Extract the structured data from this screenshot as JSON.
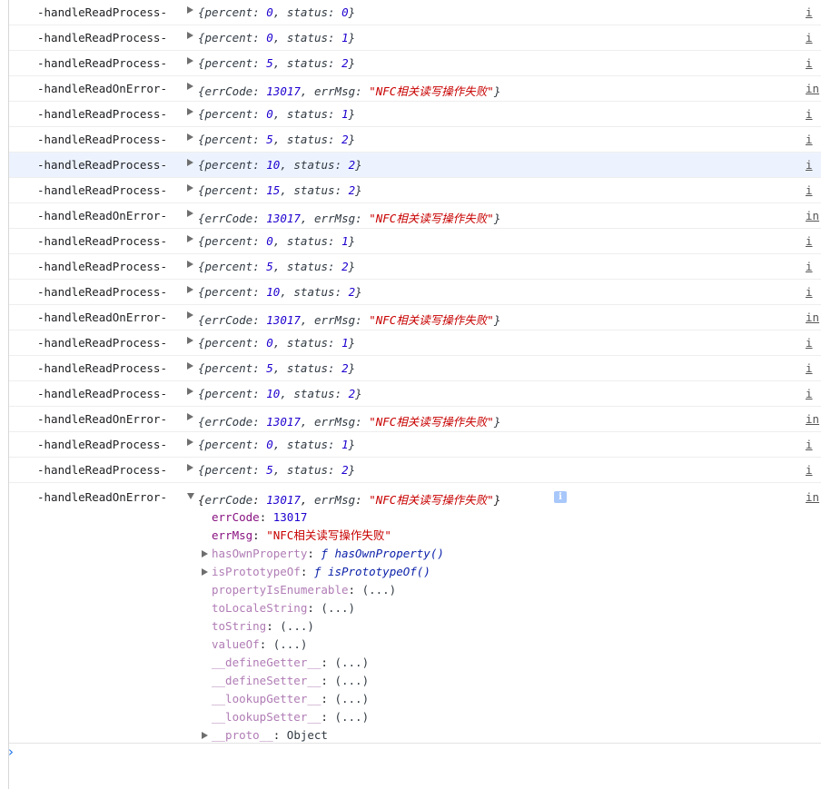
{
  "logs": [
    {
      "label": "-handleReadProcess-",
      "kind": "progress",
      "percent": "0",
      "status": "0",
      "src": "i"
    },
    {
      "label": "-handleReadProcess-",
      "kind": "progress",
      "percent": "0",
      "status": "1",
      "src": "i"
    },
    {
      "label": "-handleReadProcess-",
      "kind": "progress",
      "percent": "5",
      "status": "2",
      "src": "i"
    },
    {
      "label": "-handleReadOnError-",
      "kind": "error",
      "errCode": "13017",
      "errMsg": "\"NFC相关读写操作失败\"",
      "src": "in"
    },
    {
      "label": "-handleReadProcess-",
      "kind": "progress",
      "percent": "0",
      "status": "1",
      "src": "i"
    },
    {
      "label": "-handleReadProcess-",
      "kind": "progress",
      "percent": "5",
      "status": "2",
      "src": "i"
    },
    {
      "label": "-handleReadProcess-",
      "kind": "progress",
      "percent": "10",
      "status": "2",
      "src": "i",
      "highlight": true
    },
    {
      "label": "-handleReadProcess-",
      "kind": "progress",
      "percent": "15",
      "status": "2",
      "src": "i"
    },
    {
      "label": "-handleReadOnError-",
      "kind": "error",
      "errCode": "13017",
      "errMsg": "\"NFC相关读写操作失败\"",
      "src": "in"
    },
    {
      "label": "-handleReadProcess-",
      "kind": "progress",
      "percent": "0",
      "status": "1",
      "src": "i"
    },
    {
      "label": "-handleReadProcess-",
      "kind": "progress",
      "percent": "5",
      "status": "2",
      "src": "i"
    },
    {
      "label": "-handleReadProcess-",
      "kind": "progress",
      "percent": "10",
      "status": "2",
      "src": "i"
    },
    {
      "label": "-handleReadOnError-",
      "kind": "error",
      "errCode": "13017",
      "errMsg": "\"NFC相关读写操作失败\"",
      "src": "in"
    },
    {
      "label": "-handleReadProcess-",
      "kind": "progress",
      "percent": "0",
      "status": "1",
      "src": "i"
    },
    {
      "label": "-handleReadProcess-",
      "kind": "progress",
      "percent": "5",
      "status": "2",
      "src": "i"
    },
    {
      "label": "-handleReadProcess-",
      "kind": "progress",
      "percent": "10",
      "status": "2",
      "src": "i"
    },
    {
      "label": "-handleReadOnError-",
      "kind": "error",
      "errCode": "13017",
      "errMsg": "\"NFC相关读写操作失败\"",
      "src": "in"
    },
    {
      "label": "-handleReadProcess-",
      "kind": "progress",
      "percent": "0",
      "status": "1",
      "src": "i"
    },
    {
      "label": "-handleReadProcess-",
      "kind": "progress",
      "percent": "5",
      "status": "2",
      "src": "i"
    }
  ],
  "keys": {
    "percent": "percent",
    "status": "status",
    "errCode": "errCode",
    "errMsg": "errMsg"
  },
  "expanded": {
    "label": "-handleReadOnError-",
    "errCode": "13017",
    "errMsg": "\"NFC相关读写操作失败\"",
    "src": "in",
    "info_badge": "i",
    "props": [
      {
        "key": "errCode",
        "value": "13017",
        "type": "num",
        "expandable": false,
        "dim": false
      },
      {
        "key": "errMsg",
        "value": "\"NFC相关读写操作失败\"",
        "type": "str",
        "expandable": false,
        "dim": false
      },
      {
        "key": "hasOwnProperty",
        "value": "ƒ hasOwnProperty()",
        "type": "fn",
        "expandable": true,
        "dim": true
      },
      {
        "key": "isPrototypeOf",
        "value": "ƒ isPrototypeOf()",
        "type": "fn",
        "expandable": true,
        "dim": true
      },
      {
        "key": "propertyIsEnumerable",
        "value": "(...)",
        "type": "obj",
        "expandable": false,
        "dim": true
      },
      {
        "key": "toLocaleString",
        "value": "(...)",
        "type": "obj",
        "expandable": false,
        "dim": true
      },
      {
        "key": "toString",
        "value": "(...)",
        "type": "obj",
        "expandable": false,
        "dim": true
      },
      {
        "key": "valueOf",
        "value": "(...)",
        "type": "obj",
        "expandable": false,
        "dim": true
      },
      {
        "key": "__defineGetter__",
        "value": "(...)",
        "type": "obj",
        "expandable": false,
        "dim": true
      },
      {
        "key": "__defineSetter__",
        "value": "(...)",
        "type": "obj",
        "expandable": false,
        "dim": true
      },
      {
        "key": "__lookupGetter__",
        "value": "(...)",
        "type": "obj",
        "expandable": false,
        "dim": true
      },
      {
        "key": "__lookupSetter__",
        "value": "(...)",
        "type": "obj",
        "expandable": false,
        "dim": true
      },
      {
        "key": "__proto__",
        "value": "Object",
        "type": "obj",
        "expandable": true,
        "dim": true
      }
    ]
  },
  "prompt": {
    "icon": "chevron-right-icon",
    "glyph": "›",
    "accent": "#1a73e8"
  },
  "colors": {
    "number": "#1c00cf",
    "string": "#c80000",
    "key": "#881280",
    "highlight_row": "#edf3fe"
  }
}
